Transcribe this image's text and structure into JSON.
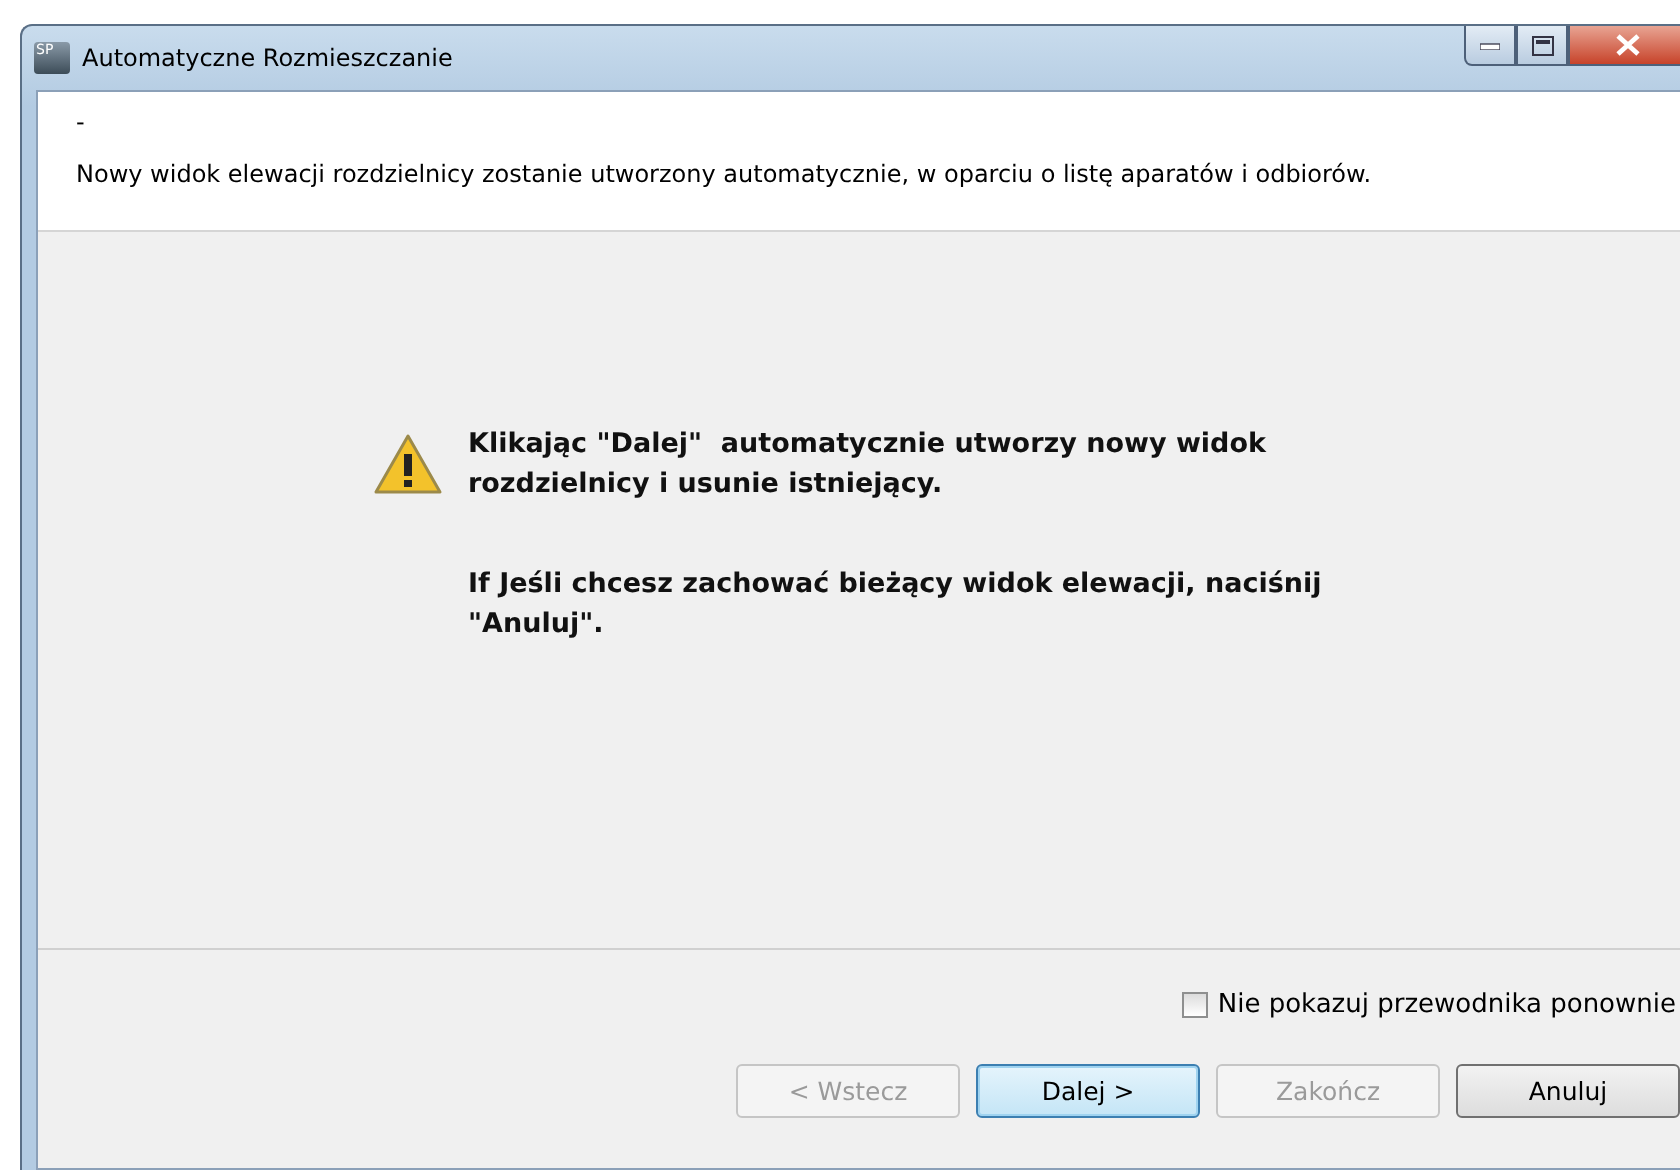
{
  "window": {
    "title": "Automatyczne Rozmieszczanie",
    "app_badge": "SP"
  },
  "header": {
    "title": "-",
    "description": "Nowy widok elewacji rozdzielnicy zostanie utworzony automatycznie, w oparciu o listę aparatów i odbiorów."
  },
  "message": {
    "paragraphs": [
      "Klikając \"Dalej\"  automatycznie utworzy nowy widok rozdzielnicy i usunie istniejący.",
      "If Jeśli chcesz zachować bieżący widok elewacji, naciśnij \"Anuluj\"."
    ]
  },
  "dont_show_again": {
    "label": "Nie pokazuj przewodnika ponownie",
    "checked": false
  },
  "buttons": [
    {
      "label": "< Wstecz",
      "disabled": true,
      "default": false
    },
    {
      "label": "Dalej >",
      "disabled": false,
      "default": true
    },
    {
      "label": "Zakończ",
      "disabled": true,
      "default": false
    },
    {
      "label": "Anuluj",
      "disabled": false,
      "default": false
    }
  ]
}
